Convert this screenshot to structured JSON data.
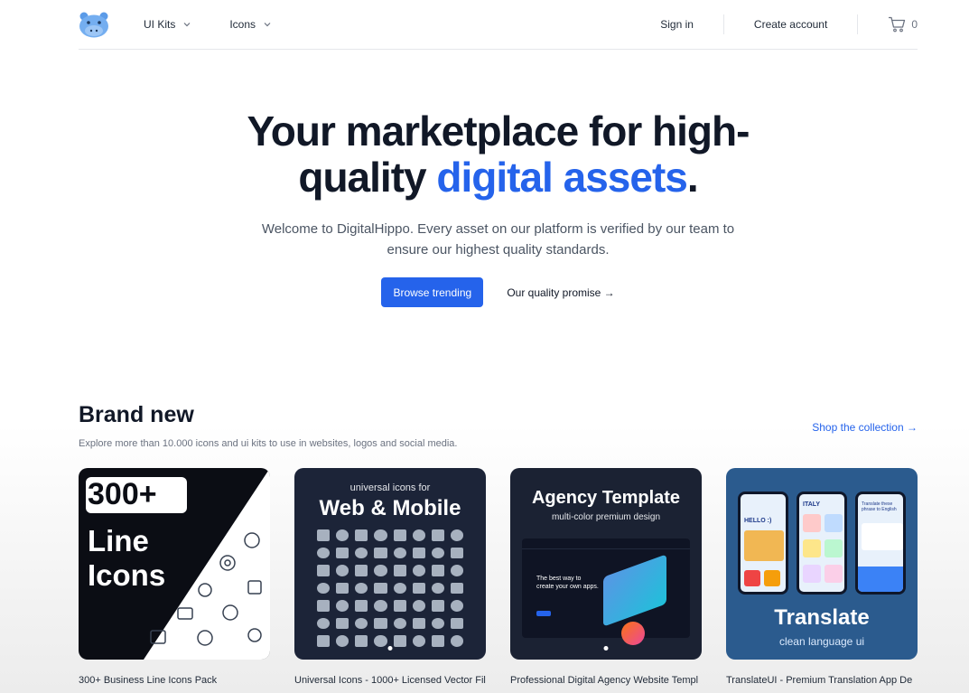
{
  "nav": {
    "ui_kits": "UI Kits",
    "icons": "Icons",
    "sign_in": "Sign in",
    "create_account": "Create account",
    "cart_count": "0"
  },
  "hero": {
    "title_part1": "Your marketplace for high-quality ",
    "title_accent": "digital assets",
    "title_end": ".",
    "subtitle": "Welcome to DigitalHippo. Every asset on our platform is verified by our team to ensure our highest quality standards.",
    "primary_cta": "Browse trending",
    "secondary_cta": "Our quality promise →"
  },
  "brand_new": {
    "heading": "Brand new",
    "subheading": "Explore more than 10.000 icons and ui kits to use in websites, logos and social media.",
    "shop_link": "Shop the collection →"
  },
  "products": [
    {
      "title": "300+ Business Line Icons Pack",
      "art": {
        "badge": "300+",
        "line1": "Line",
        "line2": "Icons"
      }
    },
    {
      "title": "Universal Icons - 1000+ Licensed Vector Fil",
      "art": {
        "small": "universal icons for",
        "big": "Web & Mobile"
      }
    },
    {
      "title": "Professional Digital Agency Website Templ",
      "art": {
        "big": "Agency Template",
        "small": "multi-color premium design",
        "tag": "The best way to create your own apps."
      }
    },
    {
      "title": "TranslateUI - Premium Translation App De",
      "art": {
        "big": "Translate",
        "small": "clean language ui",
        "p1": "HELLO :)",
        "p2": "ITALY",
        "p3": "Translate these phrase to English"
      }
    }
  ],
  "colors": {
    "accent": "#2563eb",
    "card1_bg": "#0b0d14",
    "card2_bg": "#1c2438",
    "card3_bg": "#1b2233",
    "card4_bg": "#2b5b8e"
  }
}
